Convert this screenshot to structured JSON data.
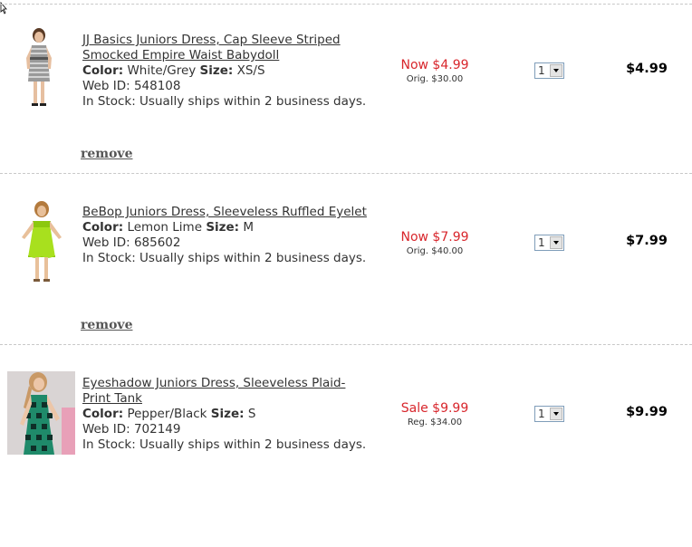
{
  "cart": {
    "items": [
      {
        "title": "JJ Basics Juniors Dress, Cap Sleeve Striped Smocked Empire Waist Babydoll",
        "color_label": "Color:",
        "color": "White/Grey",
        "size_label": "Size:",
        "size": "XS/S",
        "web_id_label": "Web ID:",
        "web_id": "548108",
        "stock": "In Stock: Usually ships within 2 business days.",
        "remove_label": "remove",
        "price_now": "Now $4.99",
        "price_orig": "Orig. $30.00",
        "quantity": "1",
        "total": "$4.99",
        "image_icon": "striped-dress-photo"
      },
      {
        "title": "BeBop Juniors Dress, Sleeveless Ruffled Eyelet",
        "color_label": "Color:",
        "color": "Lemon Lime",
        "size_label": "Size:",
        "size": "M",
        "web_id_label": "Web ID:",
        "web_id": "685602",
        "stock": "In Stock: Usually ships within 2 business days.",
        "remove_label": "remove",
        "price_now": "Now $7.99",
        "price_orig": "Orig. $40.00",
        "quantity": "1",
        "total": "$7.99",
        "image_icon": "lime-dress-photo"
      },
      {
        "title": "Eyeshadow Juniors Dress, Sleeveless Plaid-Print Tank",
        "color_label": "Color:",
        "color": "Pepper/Black",
        "size_label": "Size:",
        "size": "S",
        "web_id_label": "Web ID:",
        "web_id": "702149",
        "stock": "In Stock: Usually ships within 2 business days.",
        "price_now": "Sale $9.99",
        "price_orig": "Reg. $34.00",
        "quantity": "1",
        "total": "$9.99",
        "image_icon": "plaid-dress-photo"
      }
    ]
  },
  "colors": {
    "sale_price": "#d8262c",
    "text": "#333333",
    "divider": "#c8c8c8",
    "lime_dress": "#a8e01e",
    "plaid_dress": "#1f8a6a"
  }
}
